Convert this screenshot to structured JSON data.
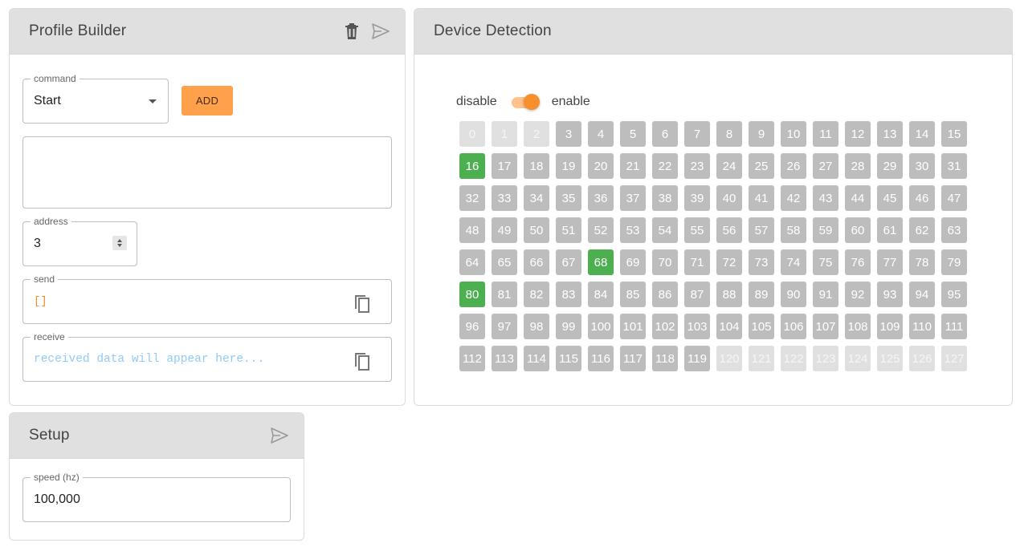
{
  "profile": {
    "title": "Profile Builder",
    "command_label": "command",
    "command_value": "Start",
    "add_label": "ADD",
    "text_area_value": "",
    "address_label": "address",
    "address_value": "3",
    "send_label": "send",
    "send_value": "[]",
    "receive_label": "receive",
    "receive_placeholder": "received data will appear here..."
  },
  "device": {
    "title": "Device Detection",
    "toggle_off_label": "disable",
    "toggle_on_label": "enable",
    "toggle_state": true,
    "address_count": 128,
    "reserved": [
      0,
      1,
      2,
      120,
      121,
      122,
      123,
      124,
      125,
      126,
      127
    ],
    "detected": [
      16,
      68,
      80
    ]
  },
  "setup": {
    "title": "Setup",
    "speed_label": "speed (hz)",
    "speed_value": "100,000"
  },
  "colors": {
    "accent": "#f7902c",
    "add_button": "#ffa14a",
    "detected": "#4caf50",
    "available": "#bdbdbd",
    "reserved": "#e0e0e0",
    "header": "#e0e0e0"
  },
  "icons": {
    "delete": "trash-icon",
    "send": "send-icon",
    "copy": "copy-icon"
  }
}
